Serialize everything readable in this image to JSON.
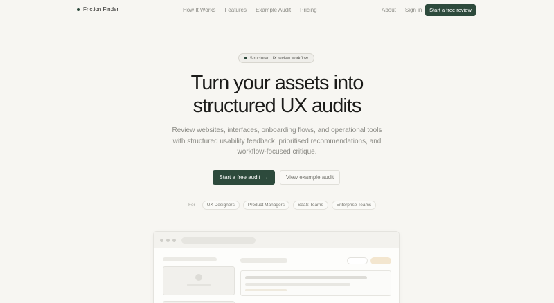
{
  "nav": {
    "brand": "Friction Finder",
    "links": [
      "How It Works",
      "Features",
      "Example Audit",
      "Pricing"
    ],
    "about": "About",
    "signin": "Sign in",
    "cta": "Start a free review"
  },
  "hero": {
    "badge": "Structured UX review workflow",
    "headline_line1": "Turn your assets into",
    "headline_line2": "structured UX audits",
    "subtext_line1": "Review websites, interfaces, onboarding flows, and operational tools",
    "subtext_line2": "with structured usability feedback, prioritised recommendations, and",
    "subtext_line3": "workflow-focused critique.",
    "cta_primary": "Start a free audit",
    "cta_primary_icon": "→",
    "cta_secondary": "View example audit"
  },
  "audience": {
    "label": "For",
    "items": [
      "UX Designers",
      "Product Managers",
      "SaaS Teams",
      "Enterprise Teams"
    ]
  },
  "colors": {
    "accent": "#2d4a3c",
    "background": "#f7f6f2"
  }
}
